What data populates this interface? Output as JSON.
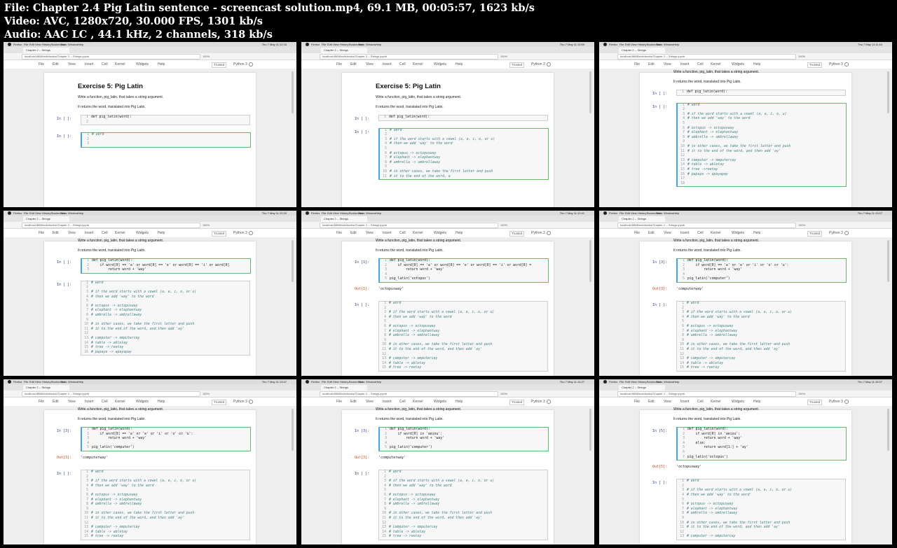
{
  "header": {
    "file_line": "File: Chapter 2.4 Pig Latin sentence - screencast solution.mp4, 69.1 MB, 00:05:57, 1623 kb/s",
    "video_line": "Video: AVC, 1280x720, 30.000 FPS, 1301 kb/s",
    "audio_line": "Audio: AAC LC , 44.1 kHz, 2 channels, 318 kb/s"
  },
  "colors": {
    "background": "#000000",
    "cell_selected_border": "#66bb6a",
    "prompt_in": "#303f9f",
    "prompt_out": "#d84315",
    "comment": "#408080"
  },
  "browser": {
    "menubar": [
      "Firefox",
      "File",
      "Edit",
      "View",
      "History",
      "Bookmarks",
      "Tools",
      "Window",
      "Help"
    ],
    "tab_title": "Chapter 2 -- Strings",
    "url": "localhost:8888/notebooks/Chapter 2 -- Strings.ipynb",
    "zoom": "150%"
  },
  "jupyter": {
    "menu": [
      "File",
      "Edit",
      "View",
      "Insert",
      "Cell",
      "Kernel",
      "Widgets",
      "Help"
    ],
    "trusted": "Trusted",
    "kernel": "Python 3"
  },
  "thumbnails": [
    {
      "clock": "Thu 7 May 11:12:16",
      "show_title": true,
      "md": [
        "Write a function, pig_latin, that takes a string argument.",
        "It returns the word, translated into Pig Latin."
      ],
      "cells": [
        {
          "prompt": "In [ ]:",
          "selected": false,
          "lines": [
            "def pig_latin(word):",
            ""
          ]
        },
        {
          "prompt": "In [ ]:",
          "selected": true,
          "lines": [
            "# word",
            "",
            ""
          ]
        }
      ]
    },
    {
      "clock": "Thu 7 May 11:10:59",
      "show_title": true,
      "md": [
        "Write a function, pig_latin, that takes a string argument.",
        "It returns the word, translated into Pig Latin."
      ],
      "cells": [
        {
          "prompt": "In [ ]:",
          "selected": false,
          "lines": [
            "def pig_latin(word):"
          ]
        },
        {
          "prompt": "In [ ]:",
          "selected": true,
          "lines": [
            "# word",
            "",
            "# if the word starts with a vowel (a, e, i, o, or u)",
            "# then we add 'way' to the word",
            "",
            "# octopus -> octopusway",
            "# elephant -> elephantway",
            "# umbrella -> umbrellaway",
            "",
            "# in other cases, we take the first letter and push",
            "# it to the end of the word, a"
          ]
        }
      ]
    },
    {
      "clock": "Thu 7 May 11:11:44",
      "show_title": false,
      "md": [
        "Write a function, pig_latin, that takes a string argument.",
        "It returns the word, translated into Pig Latin."
      ],
      "cells": [
        {
          "prompt": "In [ ]:",
          "selected": false,
          "lines": [
            "def pig_latin(word):"
          ]
        },
        {
          "prompt": "In [ ]:",
          "selected": true,
          "lines": [
            "# word",
            "",
            "# if the word starts with a vowel (a, e, i, o, u)",
            "# then we add 'way' to the word",
            "",
            "# octopus -> octopusway",
            "# elephant -> elephantway",
            "# umbrella -> umbrellaway",
            "",
            "# in other cases, we take the first letter and push",
            "# it to the end of the word, and then add 'ay'",
            "",
            "# computer -> omputercay",
            "# table -> abletay",
            "# tree ->reetay",
            "# papaya -> apayapay",
            "",
            ""
          ]
        }
      ]
    },
    {
      "clock": "Thu 7 May 11:12:20",
      "show_title": false,
      "md": [
        "Write a function, pig_latin, that takes a string argument.",
        "It returns the word, translated into Pig Latin."
      ],
      "cells": [
        {
          "prompt": "In [ ]:",
          "selected": true,
          "lines": [
            "def pig_latin(word):",
            "    if word[0] == 'a' or word[0] == 'e' or word[0] == 'i' or word[0]",
            "        return word + 'way'"
          ]
        },
        {
          "prompt": "In [ ]:",
          "selected": false,
          "lines": [
            "# word",
            "",
            "# if the word starts with a vowel (a, e, i, o, or u)",
            "# then we add 'way' to the word",
            "",
            "# octopus -> octopusway",
            "# elephant -> elephantway",
            "# umbrella -> umbrellaway",
            "",
            "# in other cases, we take the first letter and push",
            "# it to the end of the word, and then add 'ay'",
            "",
            "# computer -> omputercay",
            "# table -> abletay",
            "# tree -> reetay",
            "# papaya -> apayapay"
          ]
        }
      ]
    },
    {
      "clock": "Thu 7 May 11:12:41",
      "show_title": false,
      "md": [
        "Write a function, pig_latin, that takes a string argument.",
        "It returns the word, translated into Pig Latin."
      ],
      "cells": [
        {
          "prompt": "In [1]:",
          "selected": true,
          "lines": [
            "def pig_latin(word):",
            "    if word[0] == 'a' or word[0] == 'e' or word[0] == 'i' or word[0] =",
            "        return word + 'way'",
            "",
            "pig_latin('octopus')"
          ],
          "output_prompt": "Out[1]:",
          "output": "'octopusway'"
        },
        {
          "prompt": "In [ ]:",
          "selected": false,
          "lines": [
            "# word",
            "",
            "# if the word starts with a vowel (a, e, i, o, or u)",
            "# then we add 'way' to the word",
            "",
            "# octopus -> octopusway",
            "# elephant -> elephantway",
            "# umbrella -> umbrellaway",
            "",
            "# in other cases, we take the first letter and push",
            "# it to the end of the word, and then add 'ay'",
            "",
            "# computer -> omputercay",
            "# table -> abletay",
            "# tree -> reetay"
          ]
        }
      ]
    },
    {
      "clock": "Thu 7 May 11:13:07",
      "show_title": false,
      "md": [
        "Write a function, pig_latin, that takes a string argument.",
        "It returns the word, translated into Pig Latin."
      ],
      "cells": [
        {
          "prompt": "In [3]:",
          "selected": true,
          "lines": [
            "def pig_latin(word):",
            "    if word[0] == 'a' or 'e' or 'i' or 'o' or 'u':",
            "        return word + 'way'",
            "",
            "pig_latin('computer')"
          ],
          "output_prompt": "Out[3]:",
          "output": "'computerway'"
        },
        {
          "prompt": "In [ ]:",
          "selected": false,
          "lines": [
            "# word",
            "",
            "# if the word starts with a vowel (a, e, i, o, or u)",
            "# then we add 'way' to the word",
            "",
            "# octopus -> octopusway",
            "# elephant -> elephantway",
            "# umbrella -> umbrellaway",
            "",
            "# in other cases, we take the first letter and push",
            "# it to the end of the word, and then add 'ay'",
            "",
            "# computer -> omputercay",
            "# table -> abletay",
            "# tree -> reetay"
          ]
        }
      ]
    },
    {
      "clock": "Thu 7 May 11:13:47",
      "show_title": false,
      "md": [
        "Write a function, pig_latin, that takes a string argument.",
        "It returns the word, translated into Pig Latin."
      ],
      "cells": [
        {
          "prompt": "In [3]:",
          "selected": true,
          "lines": [
            "def pig_latin(word):",
            "    if word[0] == 'a' or 'e' or 'i' or 'o' or 'u':",
            "        return word + 'way'",
            "",
            "pig_latin('computer')"
          ],
          "output_prompt": "Out[3]:",
          "output": "'computerway'"
        },
        {
          "prompt": "In [ ]:",
          "selected": false,
          "lines": [
            "# word",
            "",
            "# if the word starts with a vowel (a, e, i, o, or u)",
            "# then we add 'way' to the word",
            "",
            "# octopus -> octopusway",
            "# elephant -> elephantway",
            "# umbrella -> umbrellaway",
            "",
            "# in other cases, we take the first letter and push",
            "# it to the end of the word, and then add 'ay'",
            "",
            "# computer -> omputercay",
            "# table -> abletay",
            "# tree -> reetay"
          ]
        }
      ]
    },
    {
      "clock": "Thu 7 May 11:14:27",
      "show_title": false,
      "md": [
        "Write a function, pig_latin, that takes a string argument.",
        "It returns the word, translated into Pig Latin."
      ],
      "cells": [
        {
          "prompt": "In [3]:",
          "selected": true,
          "lines": [
            "def pig_latin(word):",
            "    if word[0] in 'aeiou':",
            "        return word + 'way'",
            "",
            "pig_latin('computer')"
          ],
          "output_prompt": "Out[3]:",
          "output": "'computerway'"
        },
        {
          "prompt": "In [ ]:",
          "selected": false,
          "lines": [
            "# word",
            "",
            "# if the word starts with a vowel (a, e, i, o, or u)",
            "# then we add 'way' to the word",
            "",
            "# octopus -> octopusway",
            "# elephant -> elephantway",
            "# umbrella -> umbrellaway",
            "",
            "# in other cases, we take the first letter and push",
            "# it to the end of the word, and then add 'ay'",
            "",
            "# computer -> omputercay",
            "# table -> abletay",
            "# tree -> reetay"
          ]
        }
      ]
    },
    {
      "clock": "Thu 7 May 11:15:07",
      "show_title": false,
      "md": [
        "Write a function, pig_latin, that takes a string argument.",
        "It returns the word, translated into Pig Latin."
      ],
      "cells": [
        {
          "prompt": "In [5]:",
          "selected": true,
          "lines": [
            "def pig_latin(word):",
            "    if word[0] in 'aeiou':",
            "        return word + 'way'",
            "    else:",
            "        return word[1:] + 'ay'",
            "",
            "pig_latin('octopus')"
          ],
          "output_prompt": "Out[5]:",
          "output": "'octopusway'"
        },
        {
          "prompt": "In [ ]:",
          "selected": false,
          "lines": [
            "# word",
            "",
            "# if the word starts with a vowel (a, e, i, o, or u)",
            "# then we add 'way' to the word",
            "",
            "# octopus -> octopusway",
            "# elephant -> elephantway",
            "# umbrella -> umbrellaway",
            "",
            "# in other cases, we take the first letter and push",
            "# it to the end of the word, and then add 'ay'",
            "",
            "# computer -> omputercay"
          ]
        }
      ]
    }
  ],
  "exercise_title": "Exercise 5: Pig Latin"
}
